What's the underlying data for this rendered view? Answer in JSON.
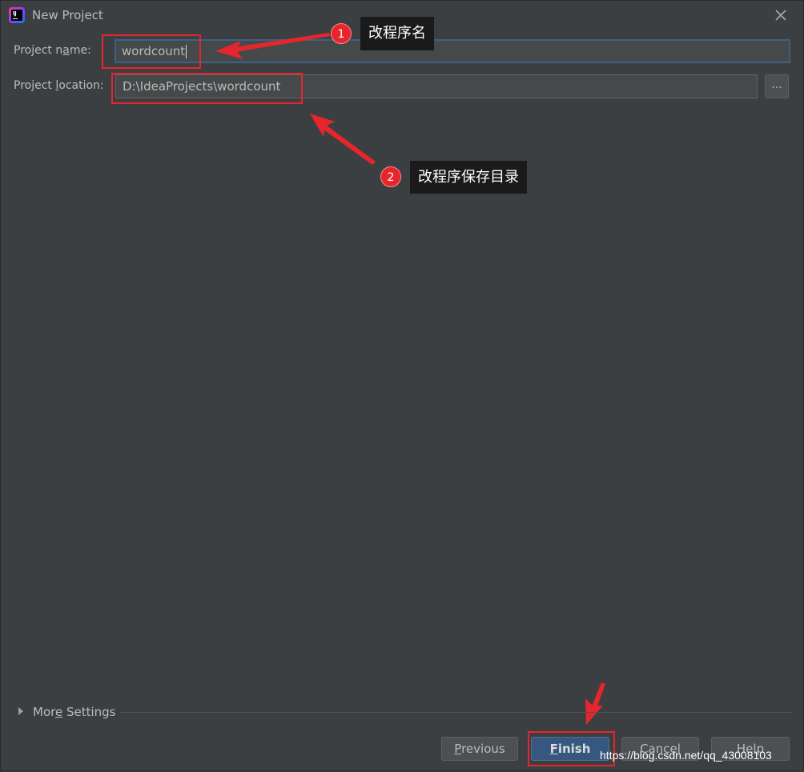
{
  "window": {
    "title": "New Project"
  },
  "form": {
    "project_name": {
      "label_prefix": "Project n",
      "label_mnemonic": "a",
      "label_suffix": "me:",
      "value": "wordcount"
    },
    "project_location": {
      "label_prefix": "Project ",
      "label_mnemonic": "l",
      "label_suffix": "ocation:",
      "value": "D:\\IdeaProjects\\wordcount",
      "browse_label": "..."
    }
  },
  "annotations": [
    {
      "number": "1",
      "text": "改程序名"
    },
    {
      "number": "2",
      "text": "改程序保存目录"
    }
  ],
  "more_settings": {
    "label_prefix": "Mor",
    "label_mnemonic": "e",
    "label_suffix": " Settings"
  },
  "buttons": {
    "previous": {
      "mnemonic": "P",
      "rest": "revious"
    },
    "finish": {
      "mnemonic": "F",
      "rest": "inish"
    },
    "cancel": "Cancel",
    "help": "Help"
  },
  "watermark": "https://blog.csdn.net/qq_43008103",
  "colors": {
    "background": "#3c3f41",
    "annotation_red": "#e6262c",
    "primary_button": "#365880",
    "focus_border": "#3d6185"
  }
}
